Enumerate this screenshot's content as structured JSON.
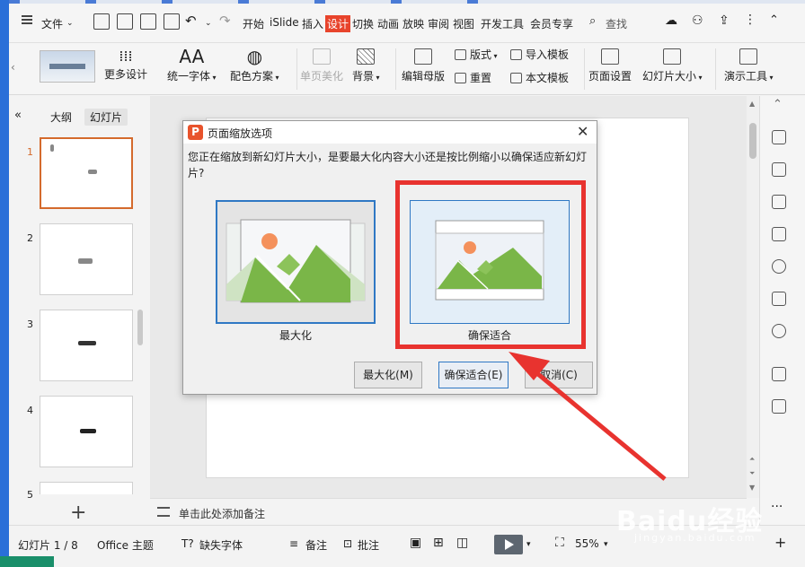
{
  "menubar": {
    "file_label": "文件",
    "tabs": [
      "开始",
      "iSlide",
      "插入",
      "设计",
      "切换",
      "动画",
      "放映",
      "审阅",
      "视图",
      "开发工具",
      "会员专享"
    ],
    "active_tab": "设计",
    "search_label": "查找"
  },
  "ribbon": {
    "more_designs": "更多设计",
    "unify_font": "统一字体",
    "color_scheme": "配色方案",
    "single_page_beautify": "单页美化",
    "background": "背景",
    "edit_master": "编辑母版",
    "layout": "版式",
    "reset": "重置",
    "import_template": "导入模板",
    "text_template": "本文模板",
    "page_setup": "页面设置",
    "slide_size": "幻灯片大小",
    "presenter_tools": "演示工具"
  },
  "leftpane": {
    "tab_outline": "大纲",
    "tab_slides": "幻灯片",
    "slides": [
      "1",
      "2",
      "3",
      "4",
      "5"
    ]
  },
  "notes_placeholder": "单击此处添加备注",
  "status": {
    "slide_indicator": "幻灯片 1 / 8",
    "theme": "Office 主题",
    "missing_font": "缺失字体",
    "notes": "备注",
    "comments": "批注",
    "zoom": "55%"
  },
  "dialog": {
    "title": "页面缩放选项",
    "message": "您正在缩放到新幻灯片大小，是要最大化内容大小还是按比例缩小以确保适应新幻灯片?",
    "option_maximize": "最大化",
    "option_ensure_fit": "确保适合",
    "btn_maximize": "最大化(M)",
    "btn_ensure_fit": "确保适合(E)",
    "btn_cancel": "取消(C)"
  },
  "watermark": {
    "brand": "Baidu经验",
    "url": "jingyan.baidu.com"
  },
  "colors": {
    "accent": "#e8442c",
    "highlight": "#e8332f",
    "selection_blue": "#2f78c4",
    "slide_selected": "#d46a2c"
  }
}
